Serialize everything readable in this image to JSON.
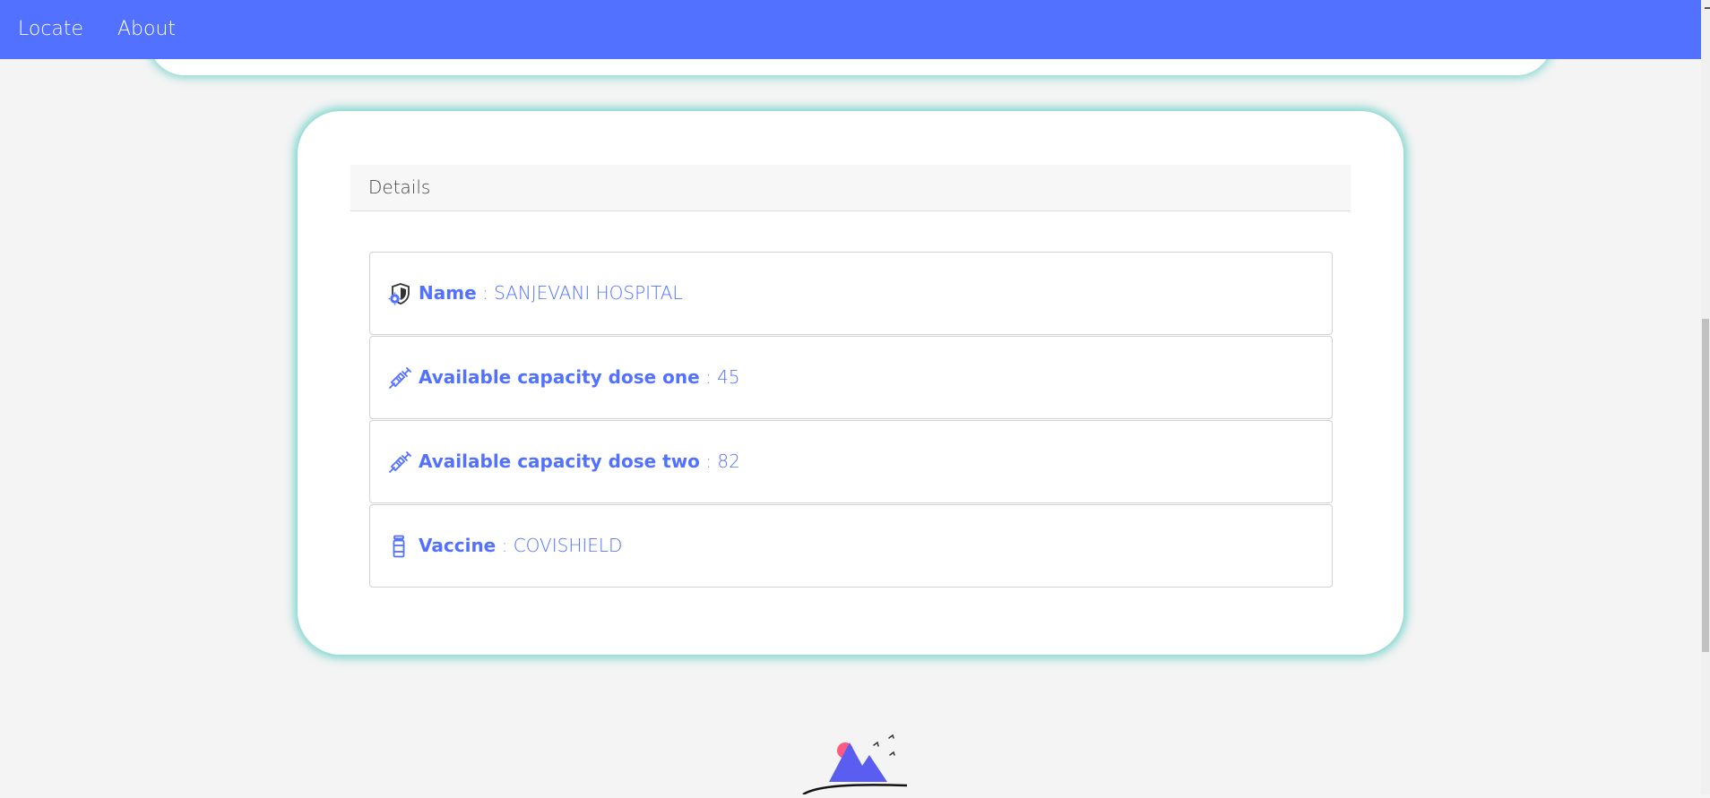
{
  "nav": {
    "links": [
      "Locate",
      "About"
    ]
  },
  "details": {
    "title": "Details",
    "items": [
      {
        "icon": "hospital-shield-icon",
        "key": "Name",
        "sep": " : ",
        "value": "SANJEVANI HOSPITAL"
      },
      {
        "icon": "syringe-icon",
        "key": "Available capacity dose one",
        "sep": " : ",
        "value": "45"
      },
      {
        "icon": "syringe-icon",
        "key": "Available capacity dose two",
        "sep": " : ",
        "value": "82"
      },
      {
        "icon": "vaccine-vial-icon",
        "key": "Vaccine",
        "sep": " : ",
        "value": "COVISHIELD"
      }
    ]
  },
  "colors": {
    "nav_bg": "#5271ff",
    "accent_text": "#5271ff",
    "card_glow": "#60cdc4",
    "page_bg": "#f4f4f4"
  },
  "footer": {
    "logo_icon": "mountains-sun-birds-icon"
  }
}
